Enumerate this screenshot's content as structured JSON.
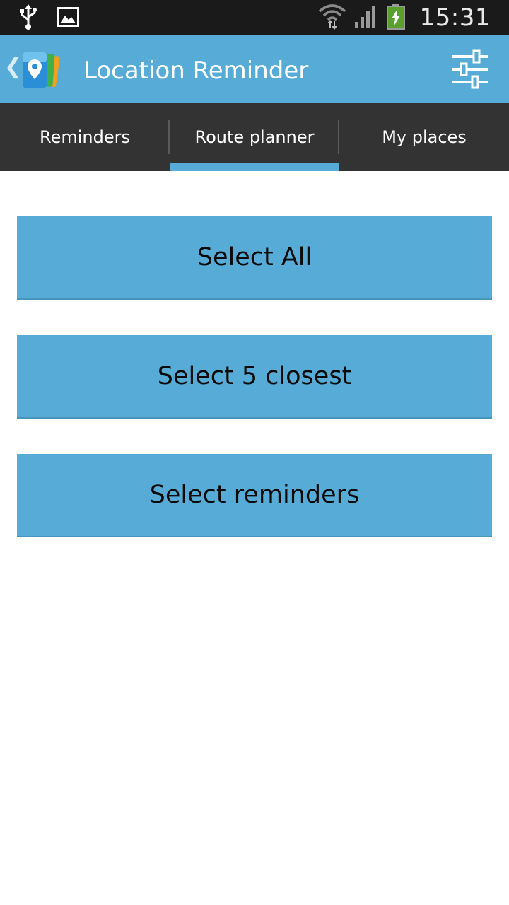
{
  "status_bar": {
    "time": "15:31",
    "icons": [
      "usb-icon",
      "image-icon",
      "wifi-icon",
      "signal-icon",
      "battery-charging-icon"
    ]
  },
  "action_bar": {
    "title": "Location Reminder",
    "logo_icon": "location-reminder-logo",
    "settings_icon": "sliders-icon"
  },
  "tabs": [
    {
      "label": "Reminders",
      "selected": false
    },
    {
      "label": "Route planner",
      "selected": true
    },
    {
      "label": "My places",
      "selected": false
    }
  ],
  "buttons": {
    "select_all": "Select All",
    "select_closest": "Select 5 closest",
    "select_reminders": "Select reminders"
  },
  "colors": {
    "accent": "#56acd6",
    "tab_background": "#333333",
    "status_background": "#1a1a1a"
  }
}
